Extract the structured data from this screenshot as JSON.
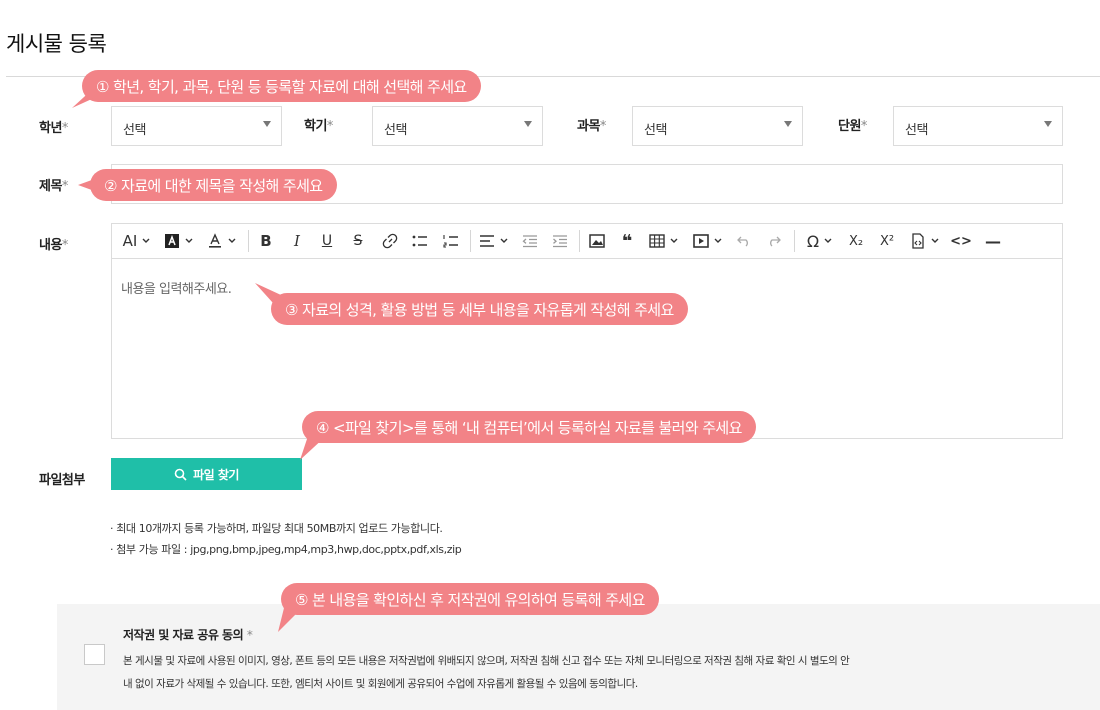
{
  "page": {
    "title": "게시물 등록"
  },
  "form": {
    "grade": {
      "label": "학년",
      "value": "선택"
    },
    "semester": {
      "label": "학기",
      "value": "선택"
    },
    "subject": {
      "label": "과목",
      "value": "선택"
    },
    "unit": {
      "label": "단원",
      "value": "선택"
    },
    "required_mark": "*",
    "title_label": "제목",
    "content_label": "내용",
    "content_placeholder": "내용을 입력해주세요.",
    "attach_label": "파일첨부",
    "attach_button": "파일 찾기",
    "notes": [
      "· 최대 10개까지 등록 가능하며, 파일당 최대 50MB까지 업로드 가능합니다.",
      "· 첨부 가능 파일 : jpg,png,bmp,jpeg,mp4,mp3,hwp,doc,pptx,pdf,xls,zip"
    ]
  },
  "toolbar": {
    "font_size": "AI",
    "bold": "B",
    "italic": "I",
    "underline": "U",
    "strike": "S",
    "quote": "❝",
    "omega": "Ω",
    "subscript": "X₂",
    "superscript": "X²",
    "source": "<>",
    "hr": "—"
  },
  "agreement": {
    "title": "저작권 및 자료 공유 동의",
    "lines": [
      "본 게시물 및 자료에 사용된 이미지, 영상, 폰트 등의 모든 내용은 저작권법에 위배되지 않으며, 저작권 침해 신고 접수 또는 자체 모니터링으로 저작권 침해 자료 확인 시 별도의 안",
      "내 없이 자료가 삭제될 수 있습니다. 또한, 엠티처 사이트 및 회원에게 공유되어 수업에 자유롭게 활용될 수 있음에 동의합니다."
    ]
  },
  "callouts": [
    "① 학년, 학기, 과목, 단원 등 등록할 자료에 대해 선택해 주세요",
    "② 자료에 대한 제목을 작성해 주세요",
    "③ 자료의 성격, 활용 방법 등 세부 내용을 자유롭게 작성해 주세요",
    "④ <파일 찾기>를 통해 ‘내 컴퓨터’에서 등록하실 자료를 불러와 주세요",
    "⑤ 본 내용을 확인하신 후 저작권에 유의하여 등록해 주세요"
  ],
  "colors": {
    "accent": "#1fbfa8",
    "callout": "#f28387"
  }
}
